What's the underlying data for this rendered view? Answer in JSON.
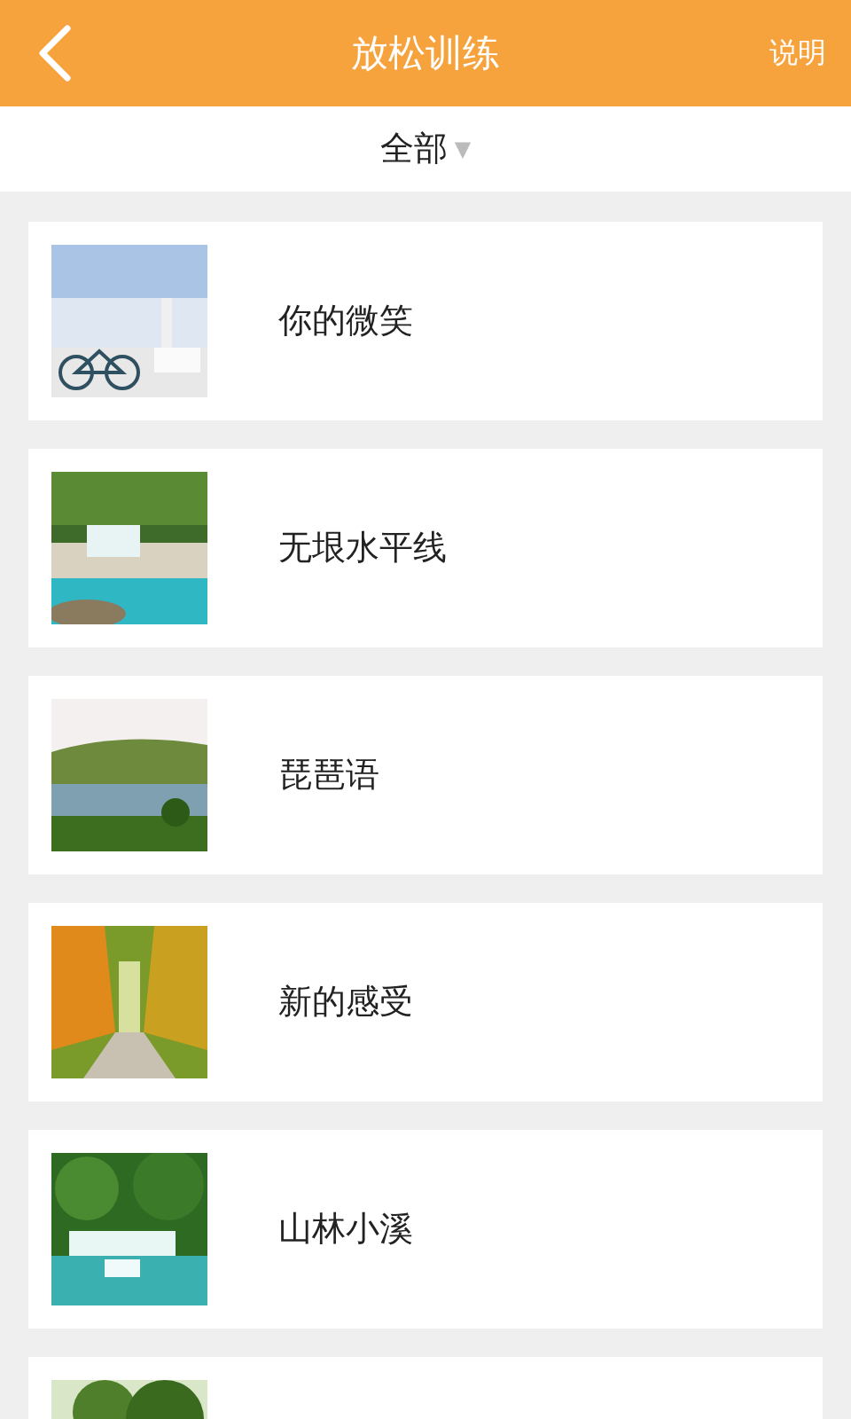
{
  "header": {
    "title": "放松训练",
    "action": "说明"
  },
  "filter": {
    "label": "全部",
    "caret": "▼"
  },
  "items": [
    {
      "kind": "picture",
      "title": "你的微笑"
    },
    {
      "kind": "picture",
      "title": "无垠水平线"
    },
    {
      "kind": "picture",
      "title": "琵琶语"
    },
    {
      "kind": "picture",
      "title": "新的感受"
    },
    {
      "kind": "picture",
      "title": "山林小溪"
    },
    {
      "kind": "picture"
    }
  ]
}
